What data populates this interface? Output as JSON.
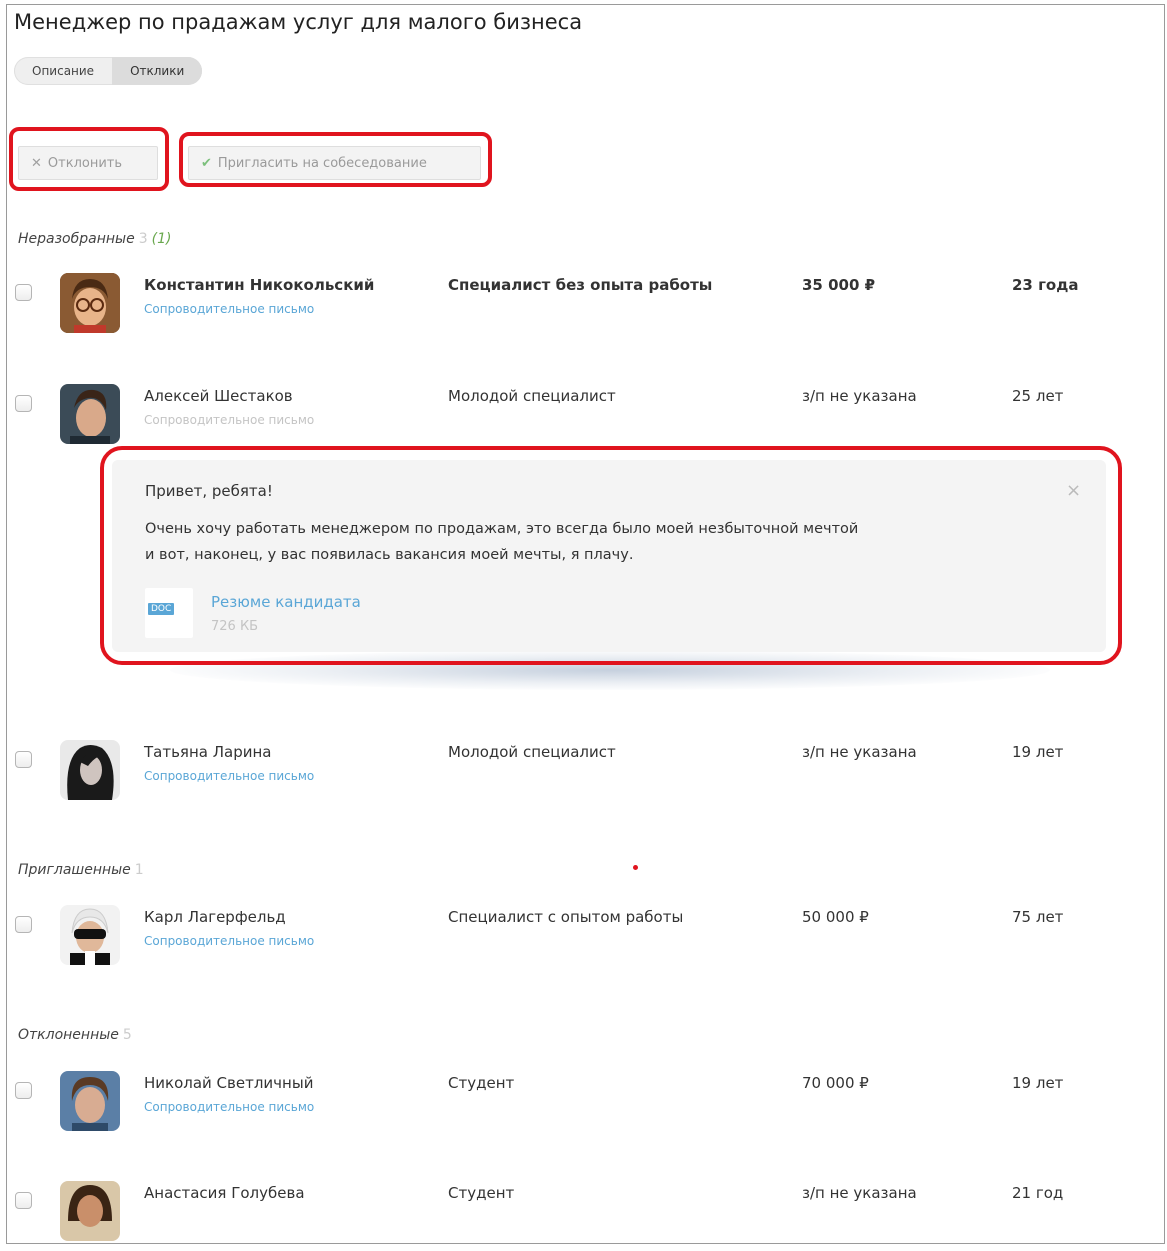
{
  "page": {
    "title": "Менеджер по прадажам услуг для малого бизнеса"
  },
  "tabs": [
    {
      "label": "Описание",
      "active": false
    },
    {
      "label": "Отклики",
      "active": true
    }
  ],
  "actions": {
    "reject_label": "Отклонить",
    "invite_label": "Пригласить на собеседование"
  },
  "sections": {
    "unsorted": {
      "title": "Неразобранные",
      "count": "3",
      "new_count": "(1)"
    },
    "invited": {
      "title": "Приглашенные",
      "count": "1"
    },
    "rejected": {
      "title": "Отклоненные",
      "count": "5"
    }
  },
  "candidates": [
    {
      "name": "Константин Никокольский",
      "cover_letter": "Сопроводительное письмо",
      "position": "Специалист без опыта работы",
      "salary": "35 000 ₽",
      "age": "23 года",
      "unread": true
    },
    {
      "name": "Алексей Шестаков",
      "cover_letter": "Сопроводительное письмо",
      "position": "Молодой специалист",
      "salary": "з/п не указана",
      "age": "25 лет",
      "unread": false
    },
    {
      "name": "Татьяна Ларина",
      "cover_letter": "Сопроводительное письмо",
      "position": "Молодой специалист",
      "salary": "з/п не указана",
      "age": "19 лет",
      "unread": false
    },
    {
      "name": "Карл Лагерфельд",
      "cover_letter": "Сопроводительное письмо",
      "position": "Специалист с опытом работы",
      "salary": "50 000  ₽",
      "age": "75 лет",
      "unread": false
    },
    {
      "name": "Николай Светличный",
      "cover_letter": "Сопроводительное письмо",
      "position": "Студент",
      "salary": "70 000 ₽",
      "age": "19 лет",
      "unread": false
    },
    {
      "name": "Анастасия Голубева",
      "cover_letter": "",
      "position": "Студент",
      "salary": "з/п не указана",
      "age": "21 год",
      "unread": false
    }
  ],
  "letter": {
    "greeting": "Привет, ребята!",
    "body_line1": "Очень хочу работать менеджером по продажам, это всегда было моей незбыточной мечтой",
    "body_line2": "и вот, наконец, у вас появилась вакансия моей мечты, я плачу.",
    "close_glyph": "×",
    "attachment": {
      "type_label": "DOC",
      "name": "Резюме кандидата",
      "size": "726 КБ"
    }
  },
  "icons": {
    "reject": "close-icon",
    "invite": "check-icon",
    "letter_close": "close-icon",
    "attachment": "doc-file-icon"
  },
  "colors": {
    "link": "#5aa6d6",
    "annotation_red": "#e0141e",
    "new_count": "#6aa84f"
  }
}
